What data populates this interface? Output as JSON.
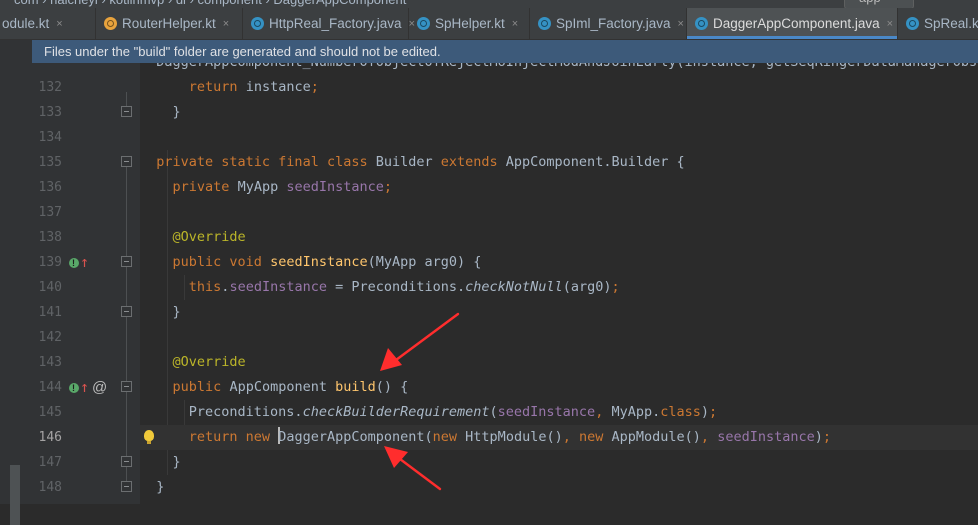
{
  "breadcrumb": {
    "items": [
      "com",
      "haicheyi",
      "kotlinmvp",
      "di",
      "component",
      "DaggerAppComponent"
    ],
    "run_config": "app"
  },
  "tabs": [
    {
      "label": "odule.kt",
      "icon": "kotlin-file-icon",
      "color": "#7f52ff",
      "active": false
    },
    {
      "label": "RouterHelper.kt",
      "icon": "kotlin-file-icon",
      "color": "#e8a33d",
      "active": false
    },
    {
      "label": "HttpReal_Factory.java",
      "icon": "java-class-icon",
      "color": "#3592c4",
      "active": false
    },
    {
      "label": "SpHelper.kt",
      "icon": "kotlin-file-icon",
      "color": "#3592c4",
      "active": false
    },
    {
      "label": "SpIml_Factory.java",
      "icon": "java-class-icon",
      "color": "#3592c4",
      "active": false
    },
    {
      "label": "DaggerAppComponent.java",
      "icon": "java-class-icon",
      "color": "#3592c4",
      "active": true
    },
    {
      "label": "SpReal.kt",
      "icon": "kotlin-file-icon",
      "color": "#3592c4",
      "active": false
    }
  ],
  "tab_close_glyph": "×",
  "banner": {
    "text": "Files under the \"build\" folder are generated and should not be edited."
  },
  "editor": {
    "current_line": 146,
    "partial_top": {
      "code": "  DaggerAppComponent_NumberOfObjectOfRejectMoInjectModAndJoinEarly(instance, getSeqRingerDataManagerObserverseq(",
      "description": "partially visible line at top, clipped"
    },
    "lines": [
      {
        "num": "132",
        "tokens": [
          {
            "t": "    "
          },
          {
            "t": "return",
            "c": "kw"
          },
          {
            "t": " instance"
          },
          {
            "t": ";",
            "c": "kw"
          }
        ]
      },
      {
        "num": "133",
        "tokens": [
          {
            "t": "  }"
          }
        ]
      },
      {
        "num": "134",
        "tokens": []
      },
      {
        "num": "135",
        "tokens": [
          {
            "t": "private static final class",
            "c": "kw"
          },
          {
            "t": " Builder "
          },
          {
            "t": "extends",
            "c": "kw"
          },
          {
            "t": " AppComponent.Builder {"
          }
        ]
      },
      {
        "num": "136",
        "tokens": [
          {
            "t": "  "
          },
          {
            "t": "private",
            "c": "kw"
          },
          {
            "t": " MyApp "
          },
          {
            "t": "seedInstance",
            "c": "fld"
          },
          {
            "t": ";",
            "c": "kw"
          }
        ]
      },
      {
        "num": "137",
        "tokens": []
      },
      {
        "num": "138",
        "tokens": [
          {
            "t": "  "
          },
          {
            "t": "@Override",
            "c": "ann"
          }
        ]
      },
      {
        "num": "139",
        "tokens": [
          {
            "t": "  "
          },
          {
            "t": "public void",
            "c": "kw"
          },
          {
            "t": " "
          },
          {
            "t": "seedInstance",
            "c": "fn"
          },
          {
            "t": "(MyApp arg0) {"
          }
        ]
      },
      {
        "num": "140",
        "tokens": [
          {
            "t": "    "
          },
          {
            "t": "this",
            "c": "kw"
          },
          {
            "t": "."
          },
          {
            "t": "seedInstance",
            "c": "fld"
          },
          {
            "t": " = Preconditions."
          },
          {
            "t": "checkNotNull",
            "c": "it"
          },
          {
            "t": "(arg0)"
          },
          {
            "t": ";",
            "c": "kw"
          }
        ]
      },
      {
        "num": "141",
        "tokens": [
          {
            "t": "  }"
          }
        ]
      },
      {
        "num": "142",
        "tokens": []
      },
      {
        "num": "143",
        "tokens": [
          {
            "t": "  "
          },
          {
            "t": "@Override",
            "c": "ann"
          }
        ]
      },
      {
        "num": "144",
        "tokens": [
          {
            "t": "  "
          },
          {
            "t": "public",
            "c": "kw"
          },
          {
            "t": " AppComponent "
          },
          {
            "t": "build",
            "c": "fn"
          },
          {
            "t": "() {"
          }
        ]
      },
      {
        "num": "145",
        "tokens": [
          {
            "t": "    Preconditions."
          },
          {
            "t": "checkBuilderRequirement",
            "c": "it"
          },
          {
            "t": "("
          },
          {
            "t": "seedInstance",
            "c": "fld"
          },
          {
            "t": ", ",
            "c": "kw"
          },
          {
            "t": "MyApp."
          },
          {
            "t": "class",
            "c": "kw"
          },
          {
            "t": ")"
          },
          {
            "t": ";",
            "c": "kw"
          }
        ]
      },
      {
        "num": "146",
        "tokens": [
          {
            "t": "    "
          },
          {
            "t": "return new",
            "c": "kw"
          },
          {
            "t": " "
          },
          {
            "t": "|CARET|"
          },
          {
            "t": "DaggerAppComponent"
          },
          {
            "t": "("
          },
          {
            "t": "new",
            "c": "kw"
          },
          {
            "t": " HttpModule()"
          },
          {
            "t": ", ",
            "c": "kw"
          },
          {
            "t": "new",
            "c": "kw"
          },
          {
            "t": " AppModule()"
          },
          {
            "t": ", ",
            "c": "kw"
          },
          {
            "t": "seedInstance",
            "c": "fld"
          },
          {
            "t": ")"
          },
          {
            "t": ";",
            "c": "kw"
          }
        ]
      },
      {
        "num": "147",
        "tokens": [
          {
            "t": "  }"
          }
        ]
      },
      {
        "num": "148",
        "tokens": [
          {
            "t": "}"
          }
        ]
      }
    ],
    "gutter_icons": [
      {
        "line": "139",
        "icons": [
          "implements-method-icon",
          "override-up-arrow-icon"
        ]
      },
      {
        "line": "144",
        "icons": [
          "implements-method-icon",
          "override-up-arrow-icon",
          "provides-at-icon"
        ]
      }
    ],
    "lightbulb_line": "146"
  },
  "annotations": {
    "arrow_color": "#ff2d2d",
    "arrows": [
      "arrow-to-build-method",
      "arrow-to-dagger-app-component"
    ]
  }
}
